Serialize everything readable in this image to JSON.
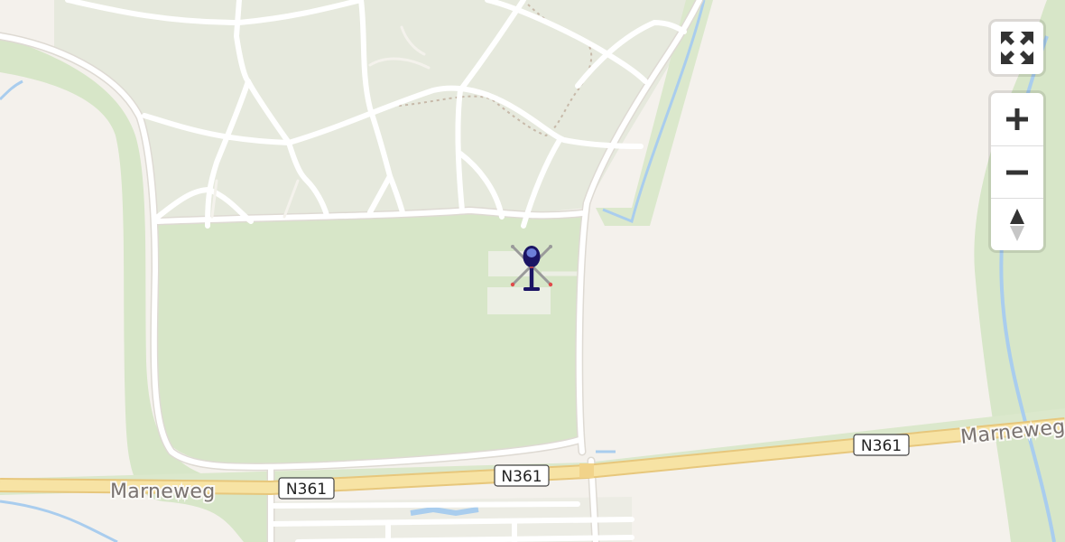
{
  "map": {
    "roads": [
      {
        "name": "Marneweg",
        "shield": "N361"
      }
    ],
    "labels": {
      "road_left": "Marneweg",
      "road_right": "Marneweg"
    },
    "shields": {
      "left": "N361",
      "center": "N361",
      "right": "N361"
    },
    "marker": {
      "type": "helicopter-icon",
      "color": "#1b1464"
    },
    "colors": {
      "land": "#f4f1ec",
      "park": "#d7e6c8",
      "residential": "#e8ebe0",
      "water": "#a9cdee",
      "road": "#ffffff",
      "highway": "#f5dfa0"
    }
  },
  "controls": {
    "fullscreen": {
      "icon": "expand-arrows-icon"
    },
    "zoom_in": {
      "icon": "plus-icon"
    },
    "zoom_out": {
      "icon": "minus-icon"
    },
    "compass": {
      "icon": "compass-north-icon"
    }
  }
}
